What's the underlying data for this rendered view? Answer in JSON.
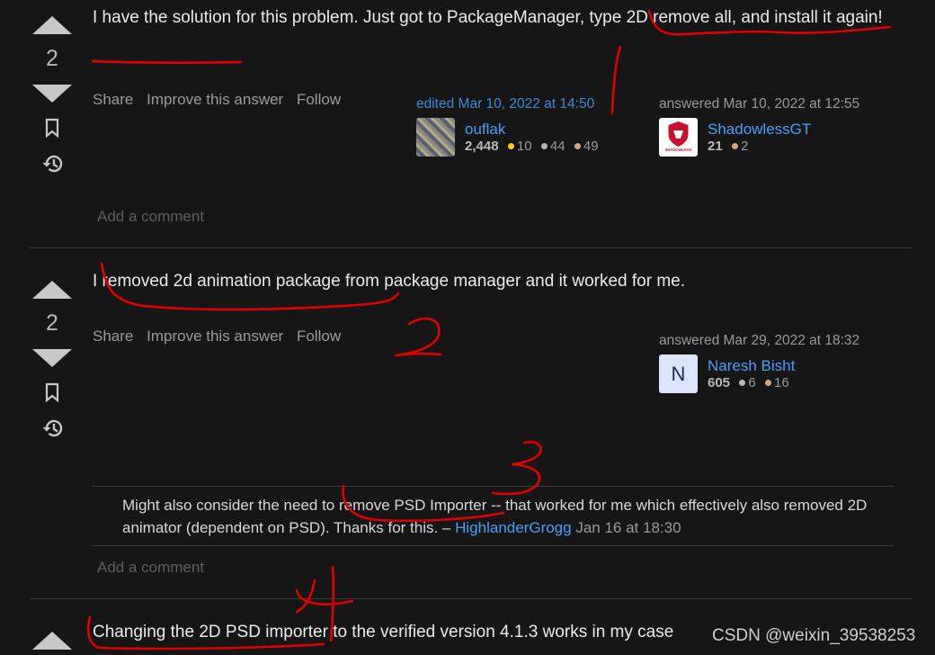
{
  "answers": [
    {
      "votes": "2",
      "text": "I have the solution for this problem. Just got to PackageManager, type 2D remove all, and install it again!",
      "menu": {
        "share": "Share",
        "improve": "Improve this answer",
        "follow": "Follow"
      },
      "edited": {
        "label": "edited Mar 10, 2022 at 14:50",
        "user": "ouflak",
        "rep": "2,448",
        "gold": "10",
        "silver": "44",
        "bronze": "49"
      },
      "answered": {
        "label": "answered Mar 10, 2022 at 12:55",
        "user": "ShadowlessGT",
        "avatar_text": "SHADOWLESS",
        "rep": "21",
        "bronze": "2"
      },
      "add_comment": "Add a comment"
    },
    {
      "votes": "2",
      "text": "I removed 2d animation package from package manager and it worked for me.",
      "menu": {
        "share": "Share",
        "improve": "Improve this answer",
        "follow": "Follow"
      },
      "answered": {
        "label": "answered Mar 29, 2022 at 18:32",
        "user": "Naresh Bisht",
        "avatar_letter": "N",
        "rep": "605",
        "silver": "6",
        "bronze": "16"
      },
      "comment": {
        "text": "Might also consider the need to remove PSD Importer -- that worked for me which effectively also removed 2D animator (dependent on PSD). Thanks for this. –",
        "user": "HighlanderGrogg",
        "time": "Jan 16 at 18:30"
      },
      "add_comment": "Add a comment"
    },
    {
      "text": "Changing the 2D PSD importer to the verified version 4.1.3 works in my case"
    }
  ],
  "watermark": "CSDN @weixin_39538253",
  "colors": {
    "background": "#161616",
    "link": "#4a9eff",
    "annotation": "#e00000"
  }
}
